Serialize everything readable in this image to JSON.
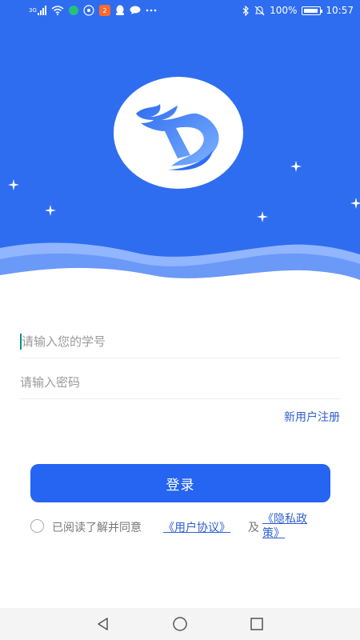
{
  "status_bar": {
    "network": "3G",
    "battery_percent": "100%",
    "time": "10:57",
    "app_badge": "2"
  },
  "login": {
    "student_id_placeholder": "请输入您的学号",
    "password_placeholder": "请输入密码",
    "register_link": "新用户注册",
    "login_button": "登录",
    "agreement_prefix": "已阅读了解并同意",
    "user_agreement": "《用户协议》",
    "and": "及",
    "privacy_policy": "《隐私政策》"
  },
  "colors": {
    "brand_blue": "#2f6df0",
    "button_blue": "#2664f2",
    "link_blue": "#2f5fd0"
  },
  "icons": [
    "signal-icon",
    "wifi-icon",
    "bluetooth-icon",
    "mute-icon",
    "battery-icon",
    "back-icon",
    "home-icon",
    "recents-icon",
    "logo-icon",
    "star-icon"
  ]
}
